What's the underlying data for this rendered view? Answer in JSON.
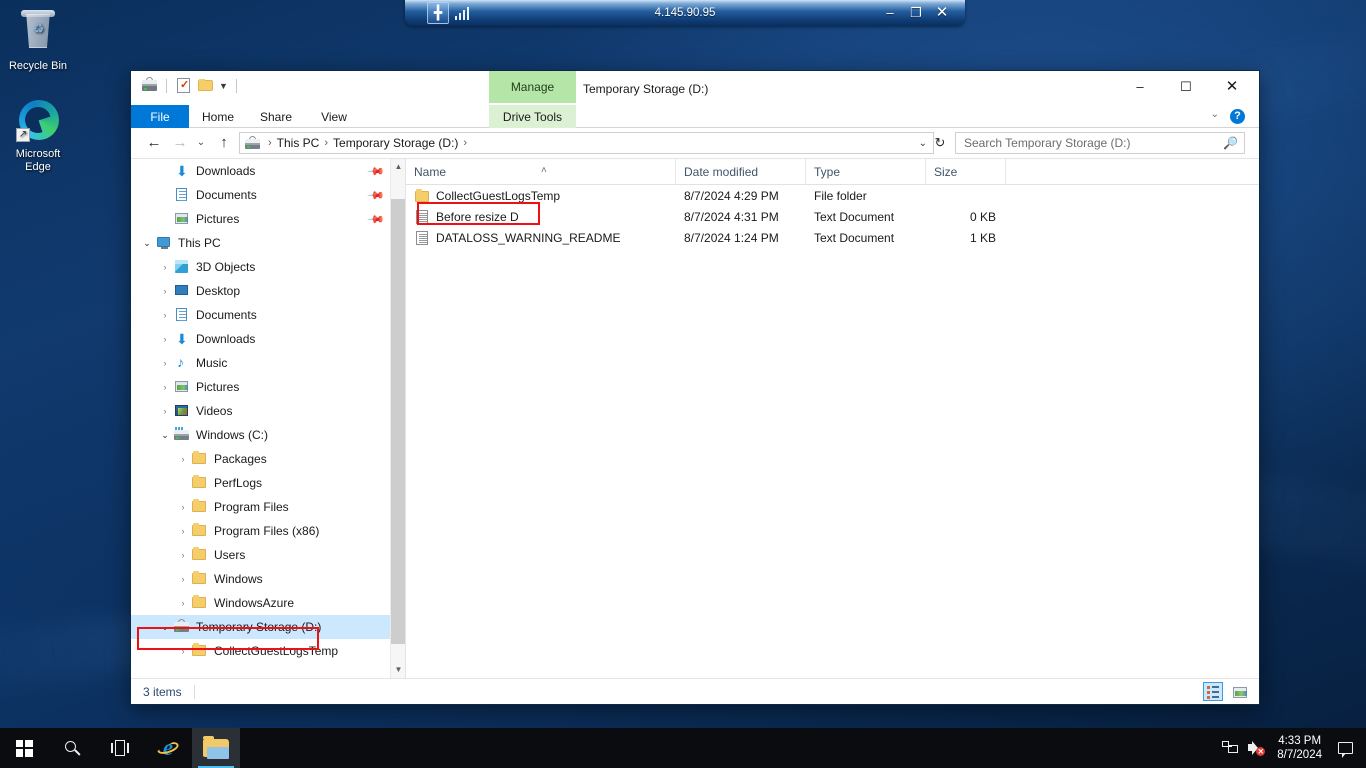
{
  "desktop": {
    "icons": [
      {
        "label": "Recycle Bin",
        "icon": "recycle-bin-icon"
      },
      {
        "label": "Microsoft\nEdge",
        "label_line1": "Microsoft",
        "label_line2": "Edge",
        "icon": "microsoft-edge-icon"
      }
    ]
  },
  "connection_bar": {
    "title": "4.145.90.95",
    "pin_icon": "pin-icon",
    "signal_icon": "signal-strength-icon",
    "minimize": "–",
    "restore": "❐",
    "close": "✕"
  },
  "explorer": {
    "window_title": "Temporary Storage (D:)",
    "quick_access": [
      {
        "name": "drive-properties-icon",
        "icon": "drive-icon"
      },
      {
        "name": "properties-icon",
        "icon": "properties-icon"
      },
      {
        "name": "new-folder-icon",
        "icon": "new-folder-icon"
      },
      {
        "name": "customize-qat-dropdown",
        "icon": "chevron-down-icon"
      }
    ],
    "window_buttons": {
      "minimize": "–",
      "maximize": "☐",
      "close": "✕"
    },
    "contextual_group": "Manage",
    "tabs": [
      {
        "label": "File",
        "active": true
      },
      {
        "label": "Home",
        "active": false
      },
      {
        "label": "Share",
        "active": false
      },
      {
        "label": "View",
        "active": false
      },
      {
        "label": "Drive Tools",
        "active": false
      }
    ],
    "ribbon_collapse": "⌄",
    "help_label": "?",
    "nav": {
      "back": "←",
      "forward": "→",
      "history": "⌄",
      "up": "↑",
      "refresh": "↻"
    },
    "breadcrumb": {
      "sep": "›",
      "items": [
        "This PC",
        "Temporary Storage (D:)"
      ],
      "trailing_sep": "›",
      "caret": "⌄"
    },
    "search": {
      "placeholder": "Search Temporary Storage (D:)",
      "value": "Search Temporary Storage (D:)",
      "icon": "search-icon"
    },
    "tree": [
      {
        "label": "Downloads",
        "icon": "downloads-icon",
        "indent": 1,
        "chevron": "",
        "pinned": true,
        "selected": false
      },
      {
        "label": "Documents",
        "icon": "documents-icon",
        "indent": 1,
        "chevron": "",
        "pinned": true,
        "selected": false
      },
      {
        "label": "Pictures",
        "icon": "pictures-icon",
        "indent": 1,
        "chevron": "",
        "pinned": true,
        "selected": false
      },
      {
        "label": "This PC",
        "icon": "this-pc-icon",
        "indent": 0,
        "chevron": "⌄",
        "pinned": false,
        "selected": false
      },
      {
        "label": "3D Objects",
        "icon": "3d-objects-icon",
        "indent": 1,
        "chevron": "›",
        "pinned": false,
        "selected": false
      },
      {
        "label": "Desktop",
        "icon": "desktop-icon",
        "indent": 1,
        "chevron": "›",
        "pinned": false,
        "selected": false
      },
      {
        "label": "Documents",
        "icon": "documents-icon",
        "indent": 1,
        "chevron": "›",
        "pinned": false,
        "selected": false
      },
      {
        "label": "Downloads",
        "icon": "downloads-icon",
        "indent": 1,
        "chevron": "›",
        "pinned": false,
        "selected": false
      },
      {
        "label": "Music",
        "icon": "music-icon",
        "indent": 1,
        "chevron": "›",
        "pinned": false,
        "selected": false
      },
      {
        "label": "Pictures",
        "icon": "pictures-icon",
        "indent": 1,
        "chevron": "›",
        "pinned": false,
        "selected": false
      },
      {
        "label": "Videos",
        "icon": "videos-icon",
        "indent": 1,
        "chevron": "›",
        "pinned": false,
        "selected": false
      },
      {
        "label": "Windows (C:)",
        "icon": "c-drive-icon",
        "indent": 1,
        "chevron": "⌄",
        "pinned": false,
        "selected": false
      },
      {
        "label": "Packages",
        "icon": "folder-icon",
        "indent": 2,
        "chevron": "›",
        "pinned": false,
        "selected": false
      },
      {
        "label": "PerfLogs",
        "icon": "folder-icon",
        "indent": 2,
        "chevron": "",
        "pinned": false,
        "selected": false
      },
      {
        "label": "Program Files",
        "icon": "folder-icon",
        "indent": 2,
        "chevron": "›",
        "pinned": false,
        "selected": false
      },
      {
        "label": "Program Files (x86)",
        "icon": "folder-icon",
        "indent": 2,
        "chevron": "›",
        "pinned": false,
        "selected": false
      },
      {
        "label": "Users",
        "icon": "folder-icon",
        "indent": 2,
        "chevron": "›",
        "pinned": false,
        "selected": false
      },
      {
        "label": "Windows",
        "icon": "folder-icon",
        "indent": 2,
        "chevron": "›",
        "pinned": false,
        "selected": false
      },
      {
        "label": "WindowsAzure",
        "icon": "folder-icon",
        "indent": 2,
        "chevron": "›",
        "pinned": false,
        "selected": false
      },
      {
        "label": "Temporary Storage (D:)",
        "icon": "drive-icon",
        "indent": 1,
        "chevron": "⌄",
        "pinned": false,
        "selected": true
      },
      {
        "label": "CollectGuestLogsTemp",
        "icon": "folder-icon",
        "indent": 2,
        "chevron": "›",
        "pinned": false,
        "selected": false
      }
    ],
    "columns": [
      {
        "label": "Name",
        "sorted": true,
        "sort_glyph": "˄"
      },
      {
        "label": "Date modified",
        "sorted": false,
        "sort_glyph": ""
      },
      {
        "label": "Type",
        "sorted": false,
        "sort_glyph": ""
      },
      {
        "label": "Size",
        "sorted": false,
        "sort_glyph": ""
      }
    ],
    "files": [
      {
        "name": "CollectGuestLogsTemp",
        "date": "8/7/2024 4:29 PM",
        "type": "File folder",
        "size": "",
        "icon": "folder-icon",
        "highlighted": false
      },
      {
        "name": "Before resize D",
        "date": "8/7/2024 4:31 PM",
        "type": "Text Document",
        "size": "0 KB",
        "icon": "text-document-icon",
        "highlighted": true
      },
      {
        "name": "DATALOSS_WARNING_README",
        "date": "8/7/2024 1:24 PM",
        "type": "Text Document",
        "size": "1 KB",
        "icon": "text-document-icon",
        "highlighted": false
      }
    ],
    "status": {
      "items_label": "3 items"
    },
    "view_buttons": [
      {
        "name": "details-view-button",
        "icon": "details-view-icon",
        "active": true
      },
      {
        "name": "large-icons-view-button",
        "icon": "large-icons-icon",
        "active": false
      }
    ]
  },
  "taskbar": {
    "buttons": [
      {
        "name": "start-button",
        "icon": "windows-logo-icon",
        "active": false
      },
      {
        "name": "search-button",
        "icon": "search-icon",
        "active": false
      },
      {
        "name": "task-view-button",
        "icon": "task-view-icon",
        "active": false
      },
      {
        "name": "internet-explorer-button",
        "icon": "internet-explorer-icon",
        "active": false
      },
      {
        "name": "file-explorer-button",
        "icon": "file-explorer-icon",
        "active": true
      }
    ],
    "tray": {
      "network_icon": "network-icon",
      "volume_icon": "volume-muted-icon",
      "volume_badge": "✕",
      "time": "4:33 PM",
      "date": "8/7/2024",
      "action_center_icon": "action-center-icon"
    }
  },
  "annotations": {
    "accent_color": "#ee1111",
    "highlight_file": "Before resize D",
    "highlight_tree_item": "Temporary Storage (D:)"
  }
}
